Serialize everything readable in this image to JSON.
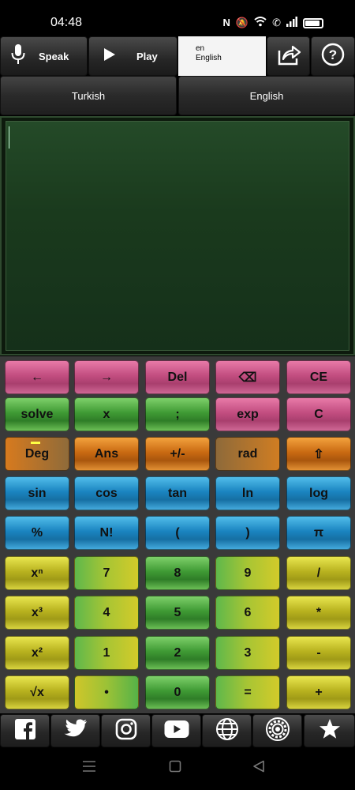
{
  "status_bar": {
    "time": "04:48",
    "icons": [
      "nfc-icon",
      "bell-off-icon",
      "wifi-icon",
      "call-icon",
      "signal-icon",
      "battery-icon"
    ]
  },
  "toolbar": {
    "speak_label": "Speak",
    "play_label": "Play",
    "lang_code": "en",
    "lang_name": "English",
    "share_icon": "share-icon",
    "help_icon": "help-icon"
  },
  "languages": {
    "source": "Turkish",
    "target": "English"
  },
  "editor": {
    "value": ""
  },
  "keypad": {
    "rows": [
      [
        "←",
        "→",
        "Del",
        "⌫",
        "CE"
      ],
      [
        "solve",
        "x",
        ";",
        "exp",
        "C"
      ],
      [
        "Deg",
        "Ans",
        "+/-",
        "rad",
        "⇧"
      ],
      [
        "sin",
        "cos",
        "tan",
        "ln",
        "log"
      ],
      [
        "%",
        "N!",
        "(",
        ")",
        "π"
      ],
      [
        "xⁿ",
        "7",
        "8",
        "9",
        "/"
      ],
      [
        "x³",
        "4",
        "5",
        "6",
        "*"
      ],
      [
        "x²",
        "1",
        "2",
        "3",
        "-"
      ],
      [
        "√x",
        "•",
        "0",
        "=",
        "+"
      ]
    ]
  },
  "social": [
    "facebook-icon",
    "twitter-icon",
    "instagram-icon",
    "youtube-icon",
    "globe-icon",
    "settings-icon",
    "star-icon"
  ],
  "colors": {
    "pink": "#c24d80",
    "green": "#3f9a34",
    "orange": "#c96a12",
    "blue": "#1a84c0",
    "yellow": "#b8b21f",
    "editor_bg": "#1a3a1d"
  }
}
